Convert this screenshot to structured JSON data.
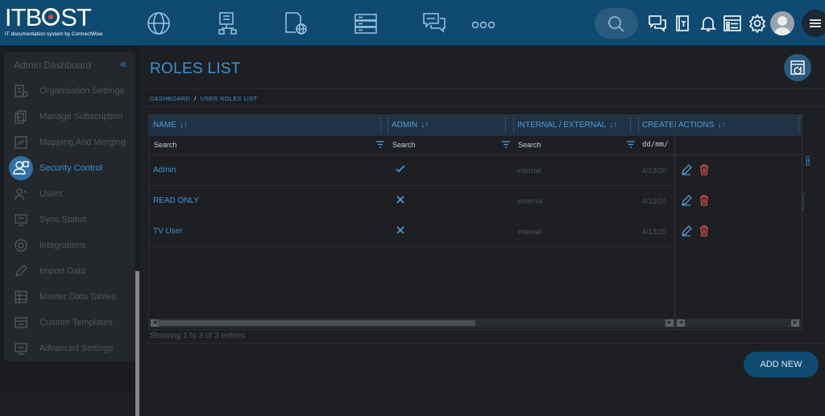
{
  "header": {
    "logo_text_a": "IT",
    "logo_text_b": "B",
    "logo_text_c": "ST",
    "logo_tagline": "IT documentation system by ConnectWise",
    "nav_icons": [
      "globe-icon",
      "org-chart-icon",
      "document-globe-icon",
      "server-icon",
      "chat-icon",
      "more-icon"
    ],
    "tool_icons": [
      "search-icon",
      "messages-icon",
      "book-icon",
      "bell-icon",
      "list-icon",
      "gear-icon",
      "avatar",
      "menu-icon"
    ]
  },
  "sidebar": {
    "title": "Admin Dashboard",
    "collapse_glyph": "«",
    "items": [
      {
        "label": "Organisation Settings",
        "icon": "organisation-icon"
      },
      {
        "label": "Manage Subscription",
        "icon": "subscription-icon"
      },
      {
        "label": "Mapping And Merging",
        "icon": "mapping-icon"
      },
      {
        "label": "Security Control",
        "icon": "security-icon",
        "active": true
      },
      {
        "label": "Users",
        "icon": "users-icon"
      },
      {
        "label": "Sync Status",
        "icon": "sync-icon"
      },
      {
        "label": "Integrations",
        "icon": "integrations-icon"
      },
      {
        "label": "Import Data",
        "icon": "import-icon"
      },
      {
        "label": "Master Data Tables",
        "icon": "table-icon"
      },
      {
        "label": "Custom Templates",
        "icon": "templates-icon"
      },
      {
        "label": "Advanced Settings",
        "icon": "advanced-icon"
      }
    ]
  },
  "page": {
    "title": "ROLES LIST",
    "breadcrumb": [
      "DASHBOARD",
      "USER ROLES LIST"
    ],
    "breadcrumb_sep": "/"
  },
  "grid": {
    "columns": [
      "NAME",
      "ADMIN",
      "INTERNAL / EXTERNAL",
      "CREATED",
      "ACTIONS"
    ],
    "sort_glyph": "↓↑",
    "filters": [
      "Search",
      "Search",
      "Search",
      "dd/mm/"
    ],
    "rows": [
      {
        "name": "Admin",
        "admin": true,
        "type": "internal",
        "created": "4/13/20"
      },
      {
        "name": "READ ONLY",
        "admin": false,
        "type": "external",
        "created": "4/13/20"
      },
      {
        "name": "TV User",
        "admin": false,
        "type": "internal",
        "created": "4/13/20"
      }
    ],
    "columns_panel": "Columns",
    "footer": "Showing 1 to 3 of 3 entries"
  },
  "actions": {
    "add_new": "ADD NEW"
  },
  "colors": {
    "header_bg": "#0f4a73",
    "accent": "#3d93d8",
    "delete": "#d9534f"
  }
}
